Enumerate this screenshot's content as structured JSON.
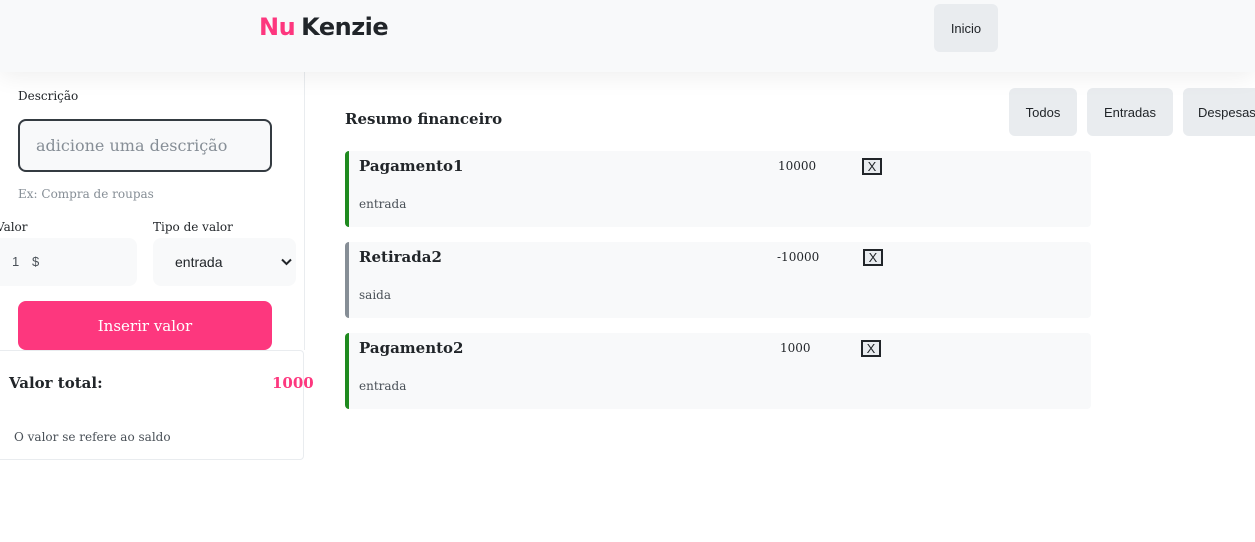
{
  "header": {
    "logo_nu": "Nu",
    "logo_kenzie": "Kenzie",
    "home_button": "Inicio"
  },
  "form": {
    "description_label": "Descrição",
    "description_placeholder": "adicione uma descrição",
    "description_hint": "Ex: Compra de roupas",
    "value_label": "Valor",
    "value_input": "1",
    "value_currency": "$",
    "type_label": "Tipo de valor",
    "type_selected": "entrada",
    "submit_button": "Inserir valor"
  },
  "total": {
    "label": "Valor total:",
    "value": "1000",
    "note": "O valor se refere ao saldo"
  },
  "summary": {
    "title": "Resumo financeiro",
    "filters": [
      "Todos",
      "Entradas",
      "Despesas"
    ],
    "transactions": [
      {
        "name": "Pagamento1",
        "value": "10000",
        "type": "entrada",
        "delete_label": "X"
      },
      {
        "name": "Retirada2",
        "value": "-10000",
        "type": "saida",
        "delete_label": "X"
      },
      {
        "name": "Pagamento2",
        "value": "1000",
        "type": "entrada",
        "delete_label": "X"
      }
    ]
  },
  "colors": {
    "brand": "#fd377e",
    "entrada_border": "#1f8a1f",
    "saida_border": "#868e96"
  }
}
